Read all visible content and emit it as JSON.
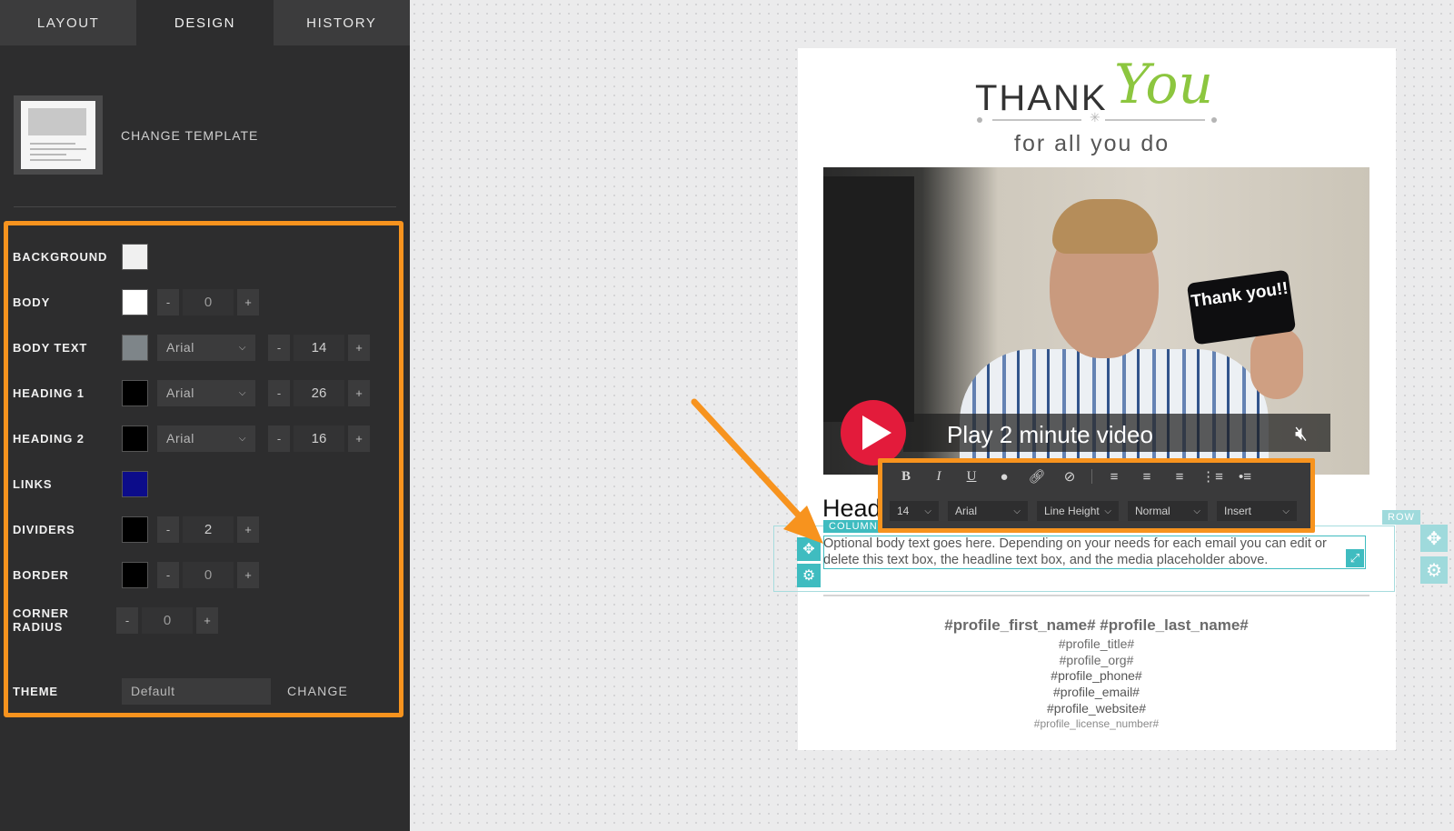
{
  "tabs": [
    "LAYOUT",
    "DESIGN",
    "HISTORY"
  ],
  "active_tab": "DESIGN",
  "template": {
    "change_label": "CHANGE TEMPLATE"
  },
  "design": {
    "background": {
      "label": "BACKGROUND",
      "color": "#f0f0f0"
    },
    "body": {
      "label": "BODY",
      "color": "#ffffff",
      "minus": "-",
      "value": "0",
      "plus": "+"
    },
    "body_text": {
      "label": "BODY TEXT",
      "color": "#7e8589",
      "font": "Arial",
      "minus": "-",
      "size": "14",
      "plus": "+"
    },
    "heading1": {
      "label": "HEADING 1",
      "color": "#000000",
      "font": "Arial",
      "minus": "-",
      "size": "26",
      "plus": "+"
    },
    "heading2": {
      "label": "HEADING 2",
      "color": "#000000",
      "font": "Arial",
      "minus": "-",
      "size": "16",
      "plus": "+"
    },
    "links": {
      "label": "LINKS",
      "color": "#0c0c8a"
    },
    "dividers": {
      "label": "DIVIDERS",
      "color": "#000000",
      "minus": "-",
      "value": "2",
      "plus": "+"
    },
    "border": {
      "label": "BORDER",
      "color": "#000000",
      "minus": "-",
      "value": "0",
      "plus": "+"
    },
    "corner_radius": {
      "label": "CORNER RADIUS",
      "minus": "-",
      "value": "0",
      "plus": "+"
    },
    "theme": {
      "label": "THEME",
      "value": "Default",
      "change": "CHANGE"
    }
  },
  "email": {
    "thank": "THANK",
    "you": "You",
    "subtitle": "for all you do",
    "video": {
      "phone_text": "Thank you!!",
      "bar_text": "Play 2 minute video",
      "mute_icon": "muted-speaker-icon",
      "mute_glyph": "🔇︎"
    },
    "heading_partial": "Head",
    "column_tag": "COLUMN",
    "row_tag": "ROW",
    "body_text": "Optional body text goes here. Depending on your needs for each email you can edit or delete this text box, the headline text box, and the media placeholder above.",
    "signature": {
      "name": "#profile_first_name# #profile_last_name#",
      "title": "#profile_title#",
      "org": "#profile_org#",
      "phone": "#profile_phone#",
      "email": "#profile_email#",
      "website": "#profile_website#",
      "license": "#profile_license_number#"
    }
  },
  "toolbar": {
    "bold": "B",
    "italic": "I",
    "underline": "U",
    "size": "14",
    "font": "Arial",
    "line_height": "Line Height",
    "style": "Normal",
    "insert": "Insert"
  },
  "accent_color": "#f7931e",
  "teal_color": "#3fbcc0"
}
